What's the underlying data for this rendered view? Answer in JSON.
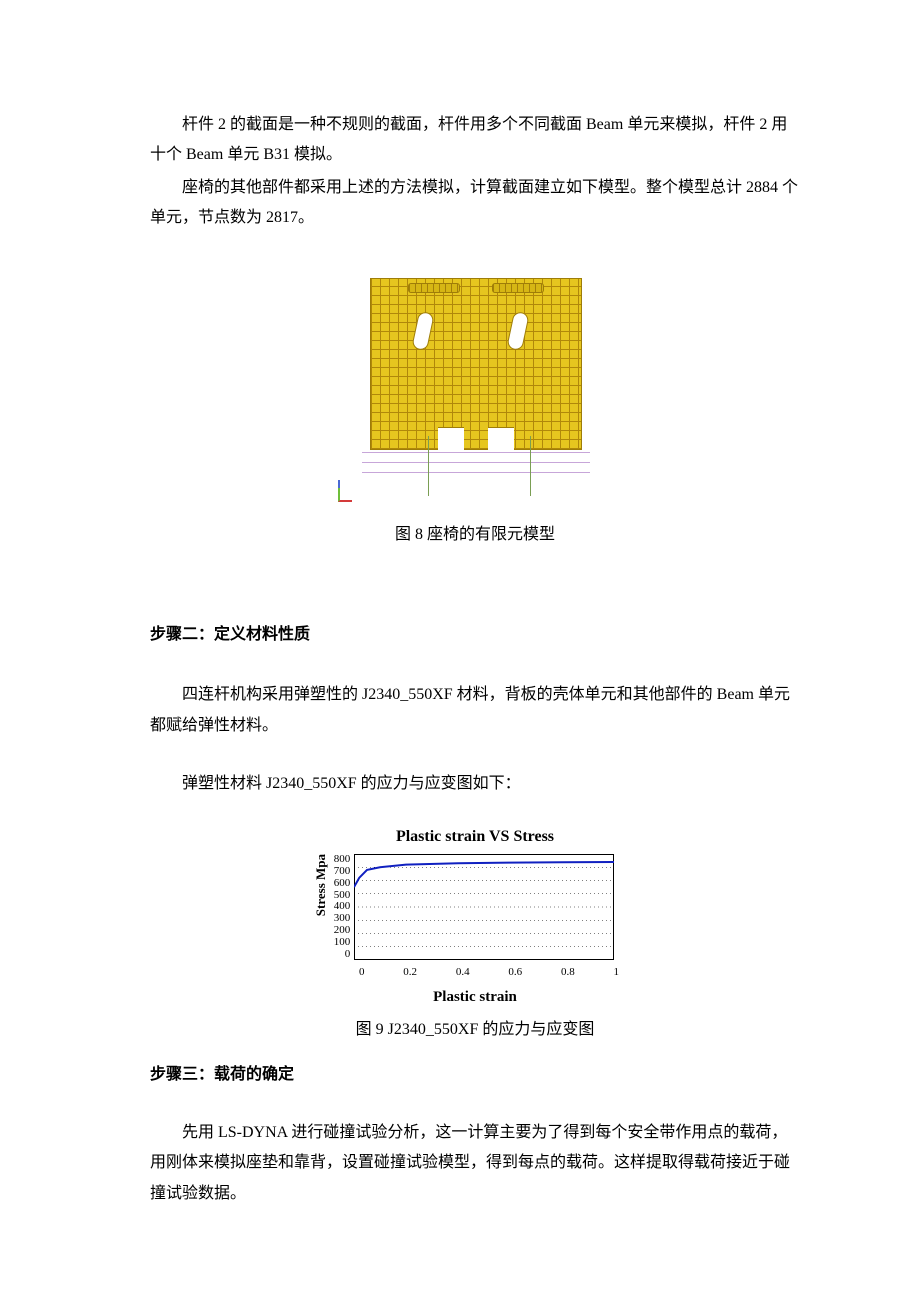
{
  "paragraphs": {
    "p1": "杆件 2 的截面是一种不规则的截面，杆件用多个不同截面 Beam 单元来模拟，杆件 2 用十个 Beam 单元 B31 模拟。",
    "p2": "座椅的其他部件都采用上述的方法模拟，计算截面建立如下模型。整个模型总计 2884 个单元，节点数为 2817。",
    "p3": "四连杆机构采用弹塑性的 J2340_550XF 材料，背板的壳体单元和其他部件的 Beam 单元都赋给弹性材料。",
    "p4": "弹塑性材料 J2340_550XF 的应力与应变图如下：",
    "p5": "先用 LS-DYNA 进行碰撞试验分析，这一计算主要为了得到每个安全带作用点的载荷，用刚体来模拟座垫和靠背，设置碰撞试验模型，得到每点的载荷。这样提取得载荷接近于碰撞试验数据。"
  },
  "captions": {
    "fig8": "图 8  座椅的有限元模型",
    "fig9": "图 9  J2340_550XF 的应力与应变图"
  },
  "sections": {
    "step2": "步骤二：定义材料性质",
    "step3": "步骤三：载荷的确定"
  },
  "chart_data": {
    "type": "line",
    "title": "Plastic strain VS Stress",
    "xlabel": "Plastic strain",
    "ylabel": "Stress Mpa",
    "x_ticks": [
      "0",
      "0.2",
      "0.4",
      "0.6",
      "0.8",
      "1"
    ],
    "y_ticks": [
      "800",
      "700",
      "600",
      "500",
      "400",
      "300",
      "200",
      "100",
      "0"
    ],
    "xlim": [
      0,
      1
    ],
    "ylim": [
      0,
      800
    ],
    "series": [
      {
        "name": "J2340_550XF",
        "x": [
          0,
          0.02,
          0.05,
          0.1,
          0.2,
          0.4,
          0.6,
          0.8,
          1.0
        ],
        "stress": [
          550,
          620,
          680,
          700,
          720,
          730,
          735,
          738,
          740
        ]
      }
    ]
  }
}
